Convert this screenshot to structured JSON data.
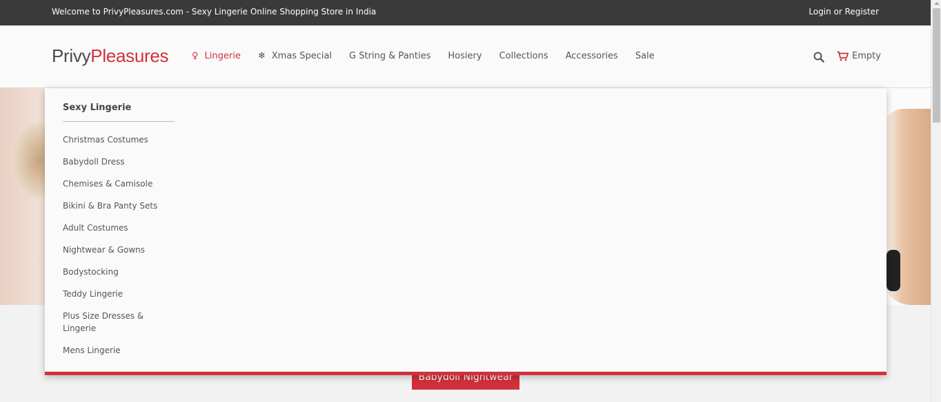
{
  "topbar": {
    "welcome": "Welcome to PrivyPleasures.com - Sexy Lingerie Online Shopping Store in India",
    "login": "Login or Register"
  },
  "logo": {
    "part1": "Privy",
    "part2": "Pleasures"
  },
  "nav": {
    "items": [
      {
        "label": "Lingerie",
        "icon": "female-icon",
        "active": true
      },
      {
        "label": "Xmas Special",
        "icon": "snowflake-icon",
        "active": false
      },
      {
        "label": "G String & Panties"
      },
      {
        "label": "Hosiery"
      },
      {
        "label": "Collections"
      },
      {
        "label": "Accessories"
      },
      {
        "label": "Sale"
      }
    ]
  },
  "cart": {
    "label": "Empty",
    "icon": "cart-icon"
  },
  "search": {
    "icon": "search-icon"
  },
  "dropdown": {
    "heading": "Sexy Lingerie",
    "items": [
      "Christmas Costumes",
      "Babydoll Dress",
      "Chemises & Camisole",
      "Bikini & Bra Panty Sets",
      "Adult Costumes",
      "Nightwear & Gowns",
      "Bodystocking",
      "Teddy Lingerie",
      "Plus Size Dresses & Lingerie",
      "Mens Lingerie"
    ]
  },
  "promo": {
    "label": "Babydoll Nightwear"
  },
  "colors": {
    "accent": "#d2303a",
    "topbar": "#3a3a3a"
  }
}
